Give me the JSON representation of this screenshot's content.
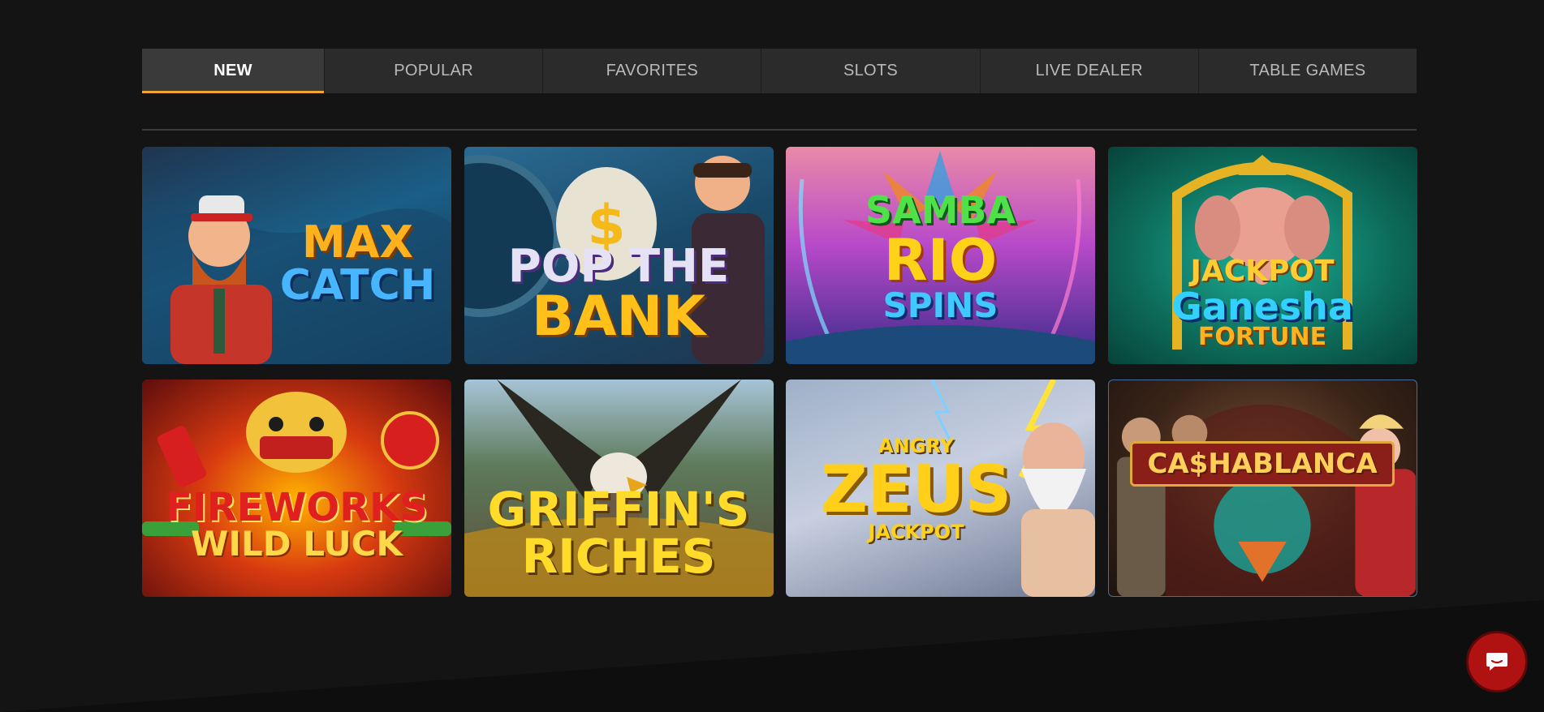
{
  "tabs": [
    {
      "label": "NEW",
      "active": true
    },
    {
      "label": "POPULAR",
      "active": false
    },
    {
      "label": "FAVORITES",
      "active": false
    },
    {
      "label": "SLOTS",
      "active": false
    },
    {
      "label": "LIVE DEALER",
      "active": false
    },
    {
      "label": "TABLE GAMES",
      "active": false
    }
  ],
  "accent_color": "#f2a531",
  "chat_button_color": "#b01212",
  "games": [
    {
      "line1": "MAX",
      "line2": "CATCH"
    },
    {
      "line1": "POP THE",
      "line2": "BANK"
    },
    {
      "line0": "SAMBA",
      "line1": "RIO",
      "line2": "SPINS"
    },
    {
      "line0": "JACKPOT",
      "line1": "Ganesha",
      "line2": "FORTUNE"
    },
    {
      "line1": "FIREWORKS",
      "line2": "WILD LUCK"
    },
    {
      "line1": "GRIFFIN'S",
      "line2": "RICHES"
    },
    {
      "line0": "ANGRY",
      "line1": "ZEUS",
      "line2": "JACKPOT"
    },
    {
      "line1": "CA$HABLANCA"
    }
  ],
  "chat_icon": "chat-bubble-icon"
}
